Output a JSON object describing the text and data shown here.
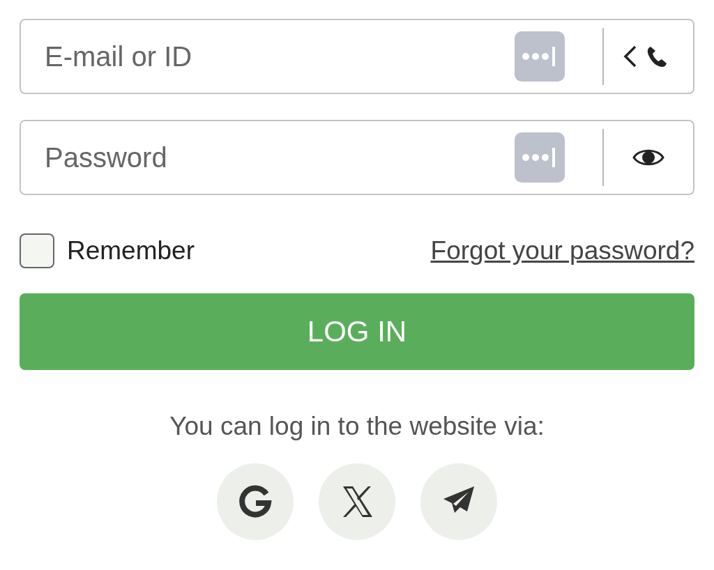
{
  "fields": [
    {
      "kind": "login",
      "placeholder": "E-mail or ID"
    },
    {
      "kind": "password",
      "placeholder": "Password"
    }
  ],
  "remember": {
    "label": "Remember",
    "checked": false
  },
  "forgot_link": "Forgot your password?",
  "login_button": "LOG IN",
  "social_prompt": "You can log in to the website via:",
  "social_buttons": [
    {
      "kind": "google"
    },
    {
      "kind": "x"
    },
    {
      "kind": "telegram"
    }
  ]
}
